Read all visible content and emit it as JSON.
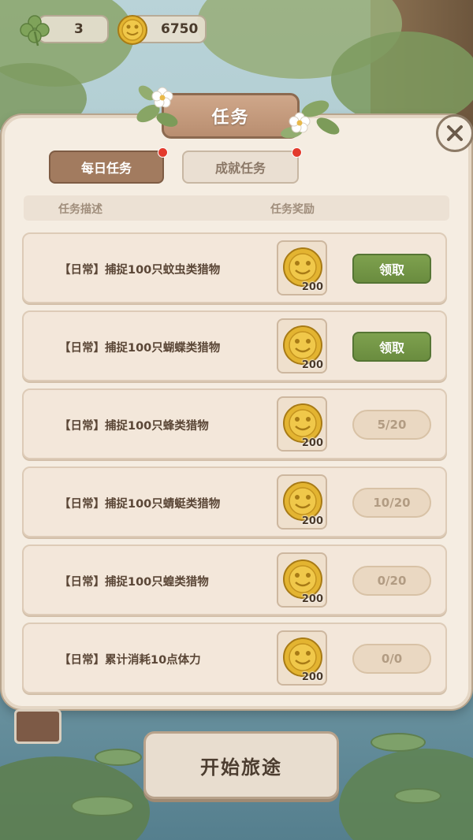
{
  "hud": {
    "clover_count": "3",
    "coins": "6750"
  },
  "panel": {
    "title": "任务",
    "tabs": [
      {
        "label": "每日任务",
        "active": true,
        "has_notification": true
      },
      {
        "label": "成就任务",
        "active": false,
        "has_notification": true
      }
    ],
    "columns": {
      "description": "任务描述",
      "reward": "任务奖励"
    },
    "tasks": [
      {
        "description": "【日常】捕捉100只蚊虫类猎物",
        "reward": "200",
        "action": "领取",
        "state": "claimable"
      },
      {
        "description": "【日常】捕捉100只蝴蝶类猎物",
        "reward": "200",
        "action": "领取",
        "state": "claimable"
      },
      {
        "description": "【日常】捕捉100只蜂类猎物",
        "reward": "200",
        "action": "5/20",
        "state": "in-progress"
      },
      {
        "description": "【日常】捕捉100只蜻蜓类猎物",
        "reward": "200",
        "action": "10/20",
        "state": "in-progress"
      },
      {
        "description": "【日常】捕捉100只蝗类猎物",
        "reward": "200",
        "action": "0/20",
        "state": "in-progress"
      },
      {
        "description": "【日常】累计消耗10点体力",
        "reward": "200",
        "action": "0/0",
        "state": "in-progress"
      }
    ]
  },
  "start_button": {
    "label": "开始旅途"
  },
  "colors": {
    "claim_green": "#6a8c3f",
    "tab_active": "#a27b5f",
    "panel_bg": "#f5ede2",
    "notification_red": "#e33a2c",
    "coin_gold": "#e3b431"
  },
  "icons": [
    "clover-icon",
    "frog-coin-icon",
    "close-icon",
    "flower-icon",
    "book-icon"
  ]
}
